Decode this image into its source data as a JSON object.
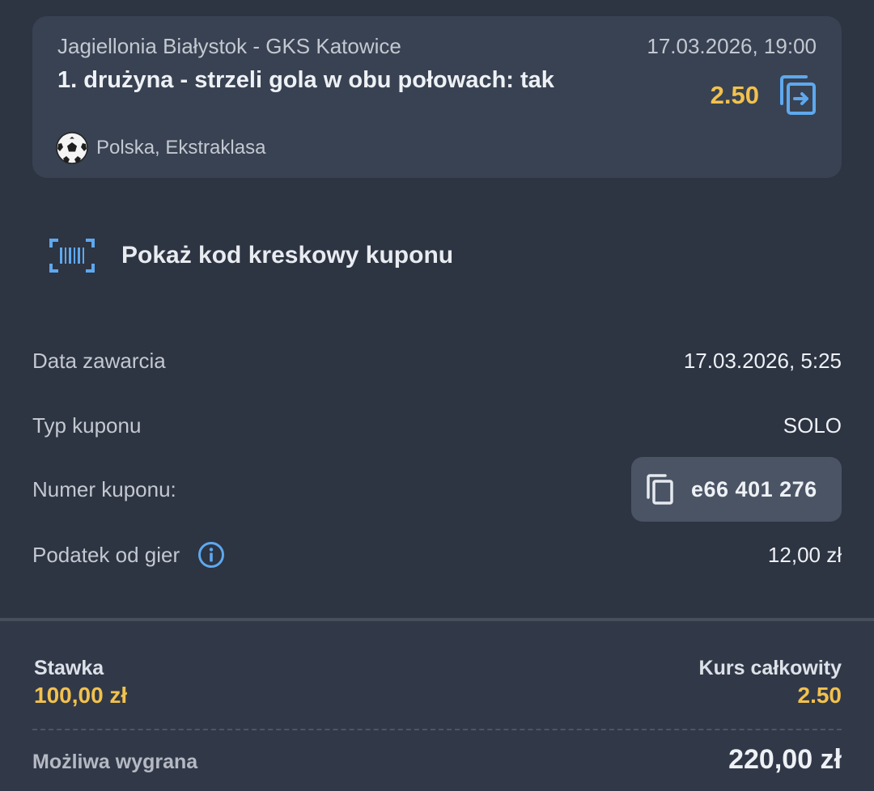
{
  "bet": {
    "match": "Jagiellonia Białystok - GKS Katowice",
    "datetime": "17.03.2026, 19:00",
    "selection": "1. drużyna - strzeli gola w obu połowach: tak",
    "odds": "2.50",
    "league": "Polska, Ekstraklasa",
    "sport_icon": "soccer-ball-icon",
    "action_icon": "swap-icon"
  },
  "barcode": {
    "label": "Pokaż kod kreskowy kuponu",
    "icon": "barcode-scan-icon"
  },
  "details": {
    "date_label": "Data zawarcia",
    "date_value": "17.03.2026, 5:25",
    "type_label": "Typ kuponu",
    "type_value": "SOLO",
    "number_label": "Numer kuponu:",
    "number_value": "e66 401 276",
    "tax_label": "Podatek od gier",
    "tax_value": "12,00 zł"
  },
  "summary": {
    "stake_label": "Stawka",
    "stake_value": "100,00 zł",
    "total_odds_label": "Kurs całkowity",
    "total_odds_value": "2.50",
    "win_label": "Możliwa wygrana",
    "win_value": "220,00 zł"
  },
  "colors": {
    "background": "#2d3442",
    "card": "#384252",
    "accent_yellow": "#f2c14e",
    "accent_blue": "#5ea8ee"
  }
}
